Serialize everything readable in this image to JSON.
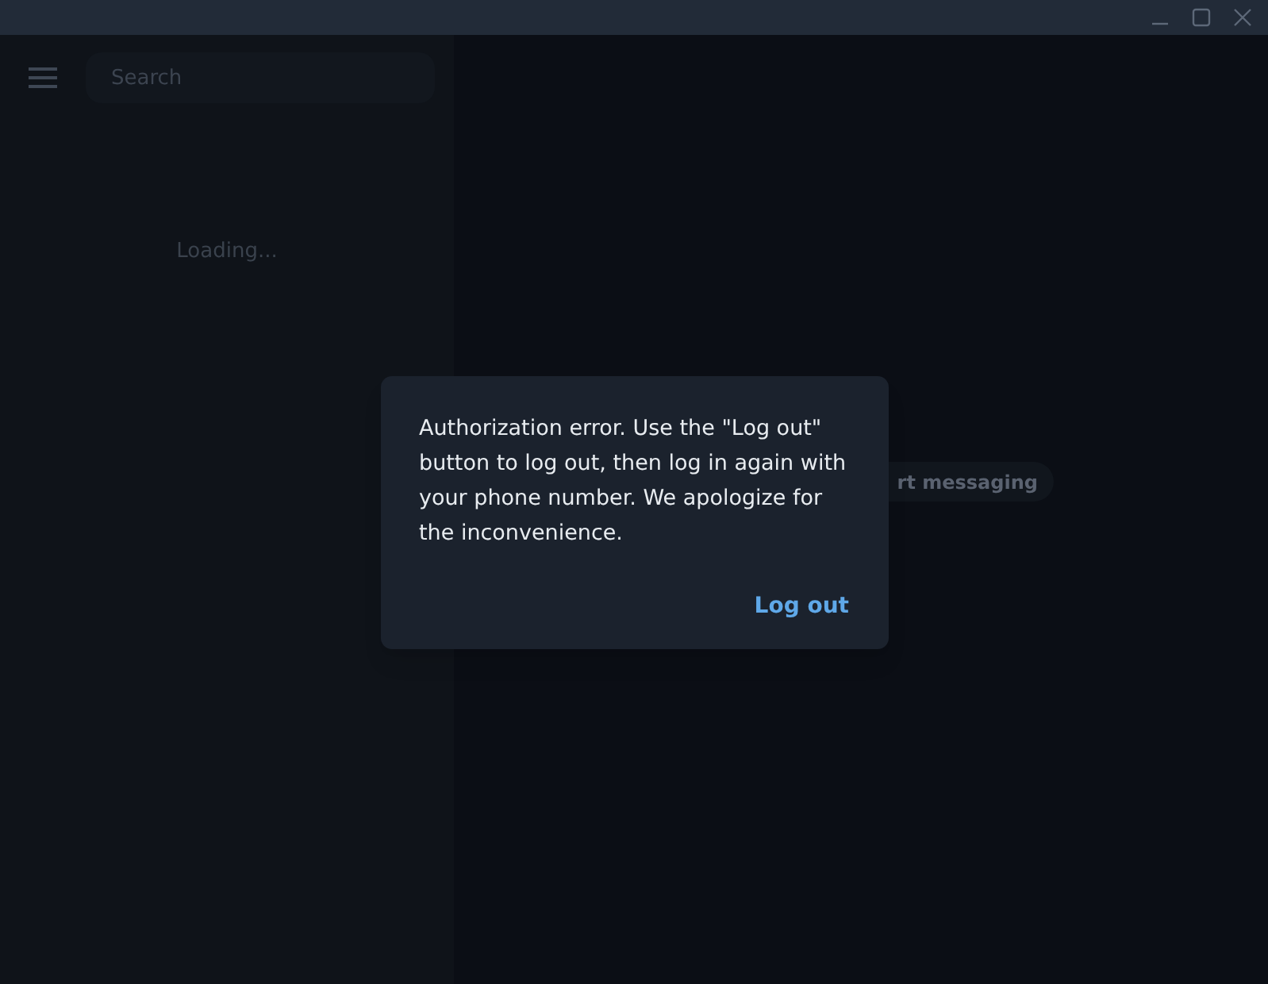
{
  "sidebar": {
    "search": {
      "placeholder": "Search"
    },
    "status": "Loading..."
  },
  "chat_area": {
    "hint": "rt messaging"
  },
  "dialog": {
    "message": "Authorization error. Use the \"Log out\" button to log out, then log in again with your phone number. We apologize for the inconvenience.",
    "button": "Log out"
  }
}
